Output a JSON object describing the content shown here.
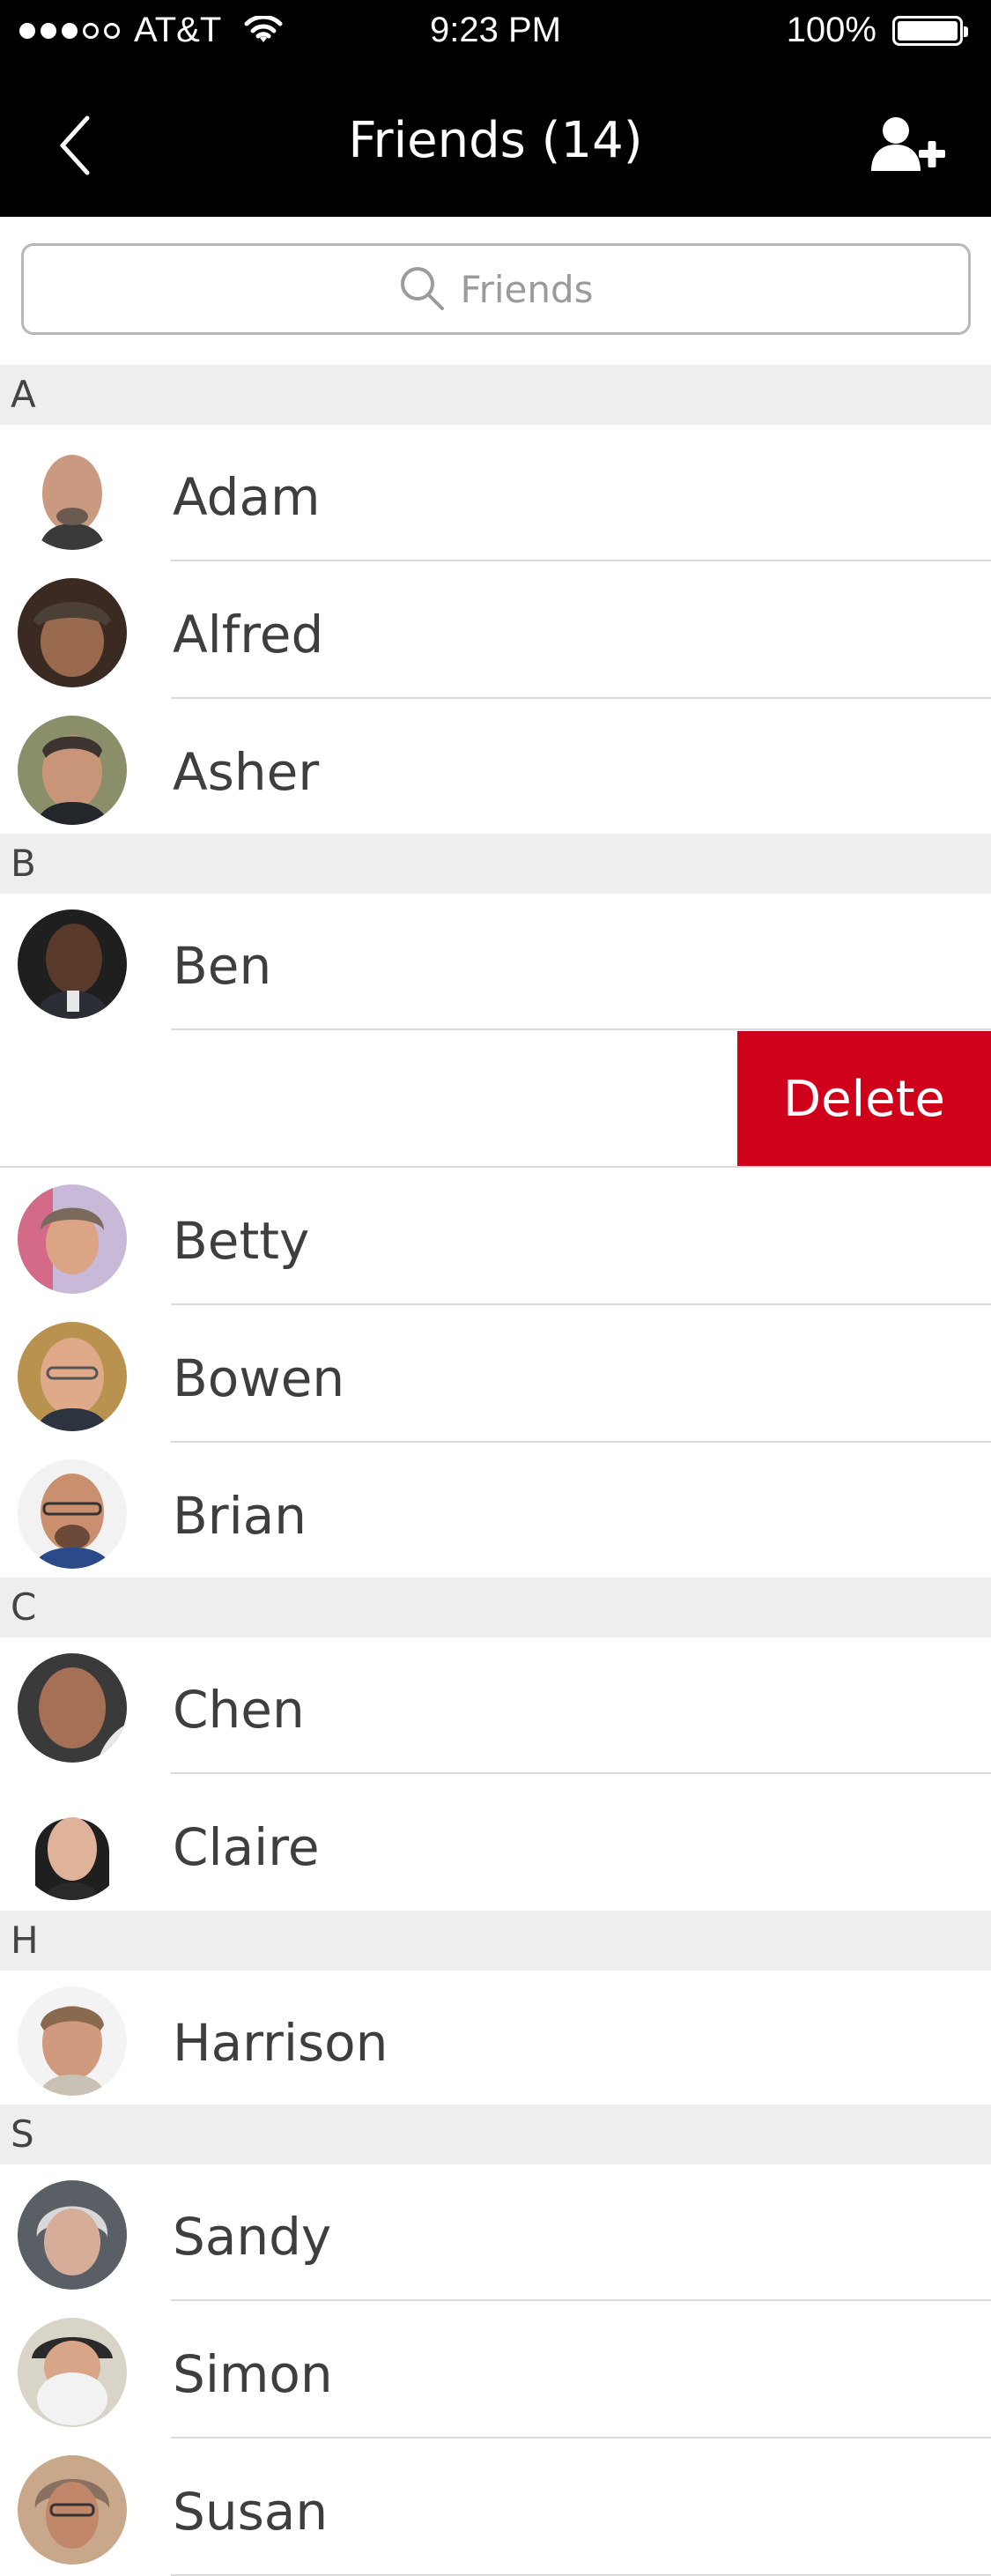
{
  "status_bar": {
    "carrier": "AT&T",
    "time": "9:23 PM",
    "battery": "100%"
  },
  "nav": {
    "title": "Friends (14)"
  },
  "search": {
    "placeholder": "Friends"
  },
  "delete_label": "Delete",
  "sections": {
    "A": {
      "letter": "A",
      "items": [
        "Adam",
        "Alfred",
        "Asher"
      ]
    },
    "B": {
      "letter": "B",
      "items": [
        "Ben",
        "Betty",
        "Bowen",
        "Brian"
      ]
    },
    "C": {
      "letter": "C",
      "items": [
        "Chen",
        "Claire"
      ]
    },
    "H": {
      "letter": "H",
      "items": [
        "Harrison"
      ]
    },
    "S": {
      "letter": "S",
      "items": [
        "Sandy",
        "Simon",
        "Susan"
      ]
    }
  },
  "colors": {
    "header_bg": "#000000",
    "delete_bg": "#d0021b",
    "section_bg": "#eeeeee"
  }
}
